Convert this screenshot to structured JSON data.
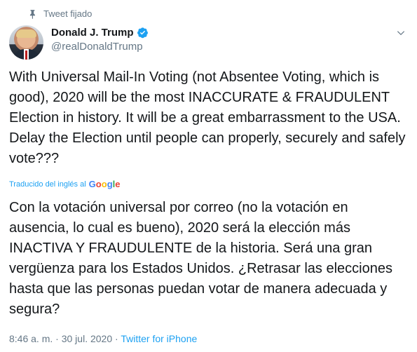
{
  "pinned": {
    "label": "Tweet fijado",
    "icon": "pin-icon"
  },
  "user": {
    "display_name": "Donald J. Trump",
    "handle": "@realDonaldTrump",
    "verified": true
  },
  "tweet": {
    "text": "With Universal Mail-In Voting (not Absentee Voting, which is good), 2020 will be the most INACCURATE & FRAUDULENT Election in history. It will be a great embarrassment to the USA. Delay the Election until people can properly, securely and safely vote???",
    "translated_label": "Traducido del inglés al",
    "translator": "Google",
    "translation": "Con la votación universal por correo (no la votación en ausencia, lo cual es bueno), 2020 será la elección más INACTIVA Y FRAUDULENTE de la historia. Será una gran vergüenza para los Estados Unidos. ¿Retrasar las elecciones hasta que las personas puedan votar de manera adecuada y segura?"
  },
  "meta": {
    "time": "8:46 a. m.",
    "separator": "·",
    "date": "30 jul. 2020",
    "source": "Twitter for iPhone"
  },
  "colors": {
    "text": "#14171a",
    "muted": "#657786",
    "accent": "#1da1f2"
  }
}
